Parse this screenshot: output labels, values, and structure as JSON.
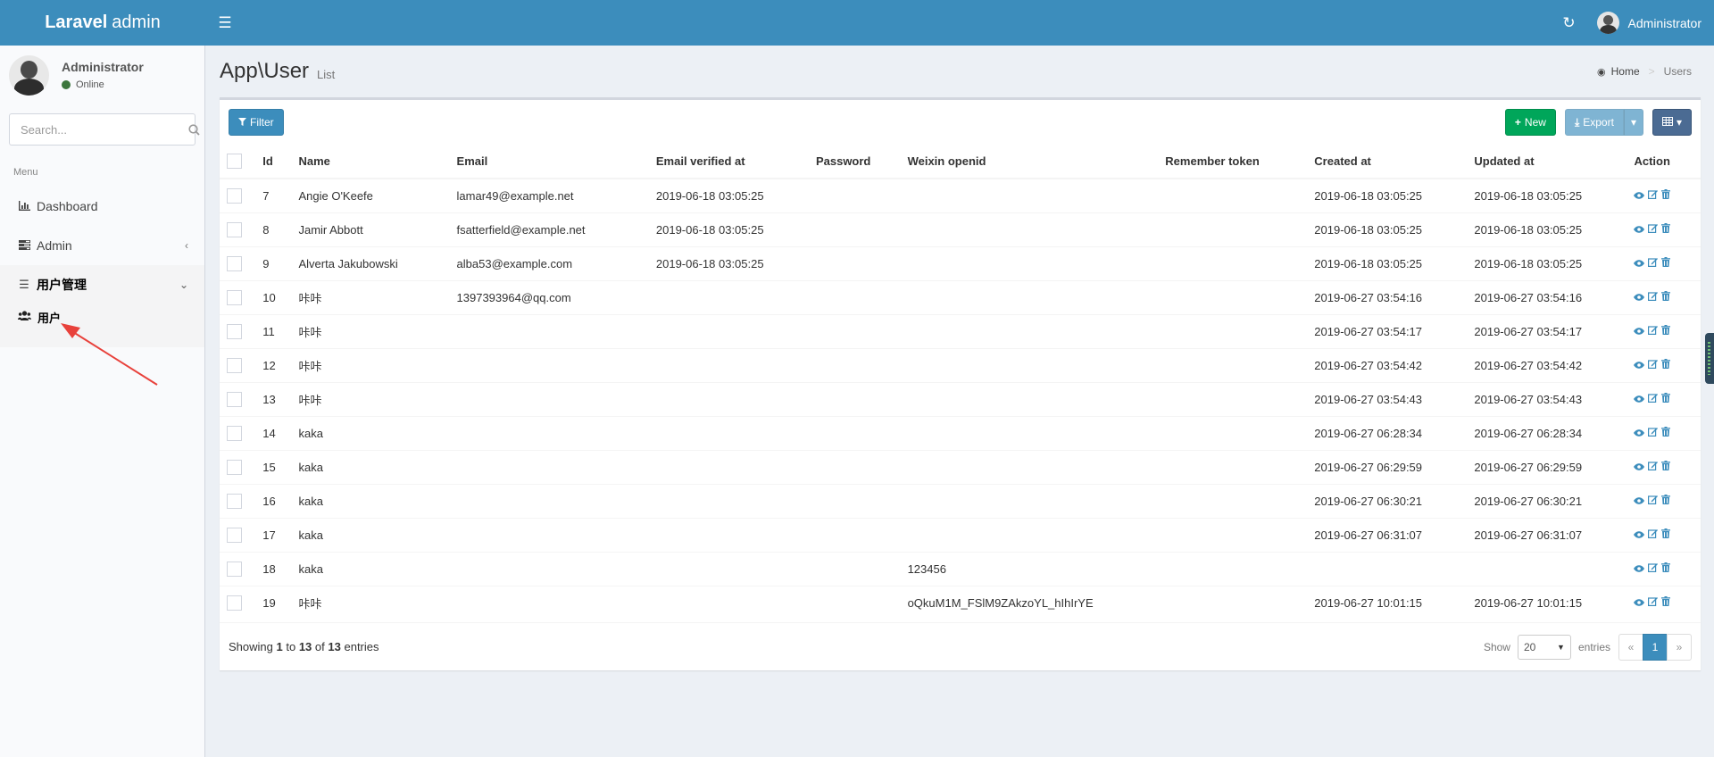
{
  "header": {
    "logo_bold": "Laravel",
    "logo_thin": "admin",
    "user_name": "Administrator"
  },
  "sidebar": {
    "user_name": "Administrator",
    "status": "Online",
    "search_placeholder": "Search...",
    "menu_header": "Menu",
    "items": [
      {
        "label": "Dashboard",
        "icon": "bar-chart-icon"
      },
      {
        "label": "Admin",
        "icon": "tasks-icon"
      },
      {
        "label": "用户管理",
        "icon": "bars-icon"
      }
    ],
    "subitems": [
      {
        "label": "用户",
        "icon": "users-icon"
      }
    ]
  },
  "page": {
    "title": "App\\User",
    "subtitle": "List",
    "breadcrumb": [
      "Home",
      "Users"
    ]
  },
  "toolbar": {
    "filter_label": "Filter",
    "new_label": "New",
    "export_label": "Export"
  },
  "table": {
    "columns": [
      "Id",
      "Name",
      "Email",
      "Email verified at",
      "Password",
      "Weixin openid",
      "Remember token",
      "Created at",
      "Updated at",
      "Action"
    ],
    "rows": [
      {
        "id": "7",
        "name": "Angie O'Keefe",
        "email": "lamar49@example.net",
        "verified": "2019-06-18 03:05:25",
        "password": "",
        "openid": "",
        "token": "",
        "created": "2019-06-18 03:05:25",
        "updated": "2019-06-18 03:05:25"
      },
      {
        "id": "8",
        "name": "Jamir Abbott",
        "email": "fsatterfield@example.net",
        "verified": "2019-06-18 03:05:25",
        "password": "",
        "openid": "",
        "token": "",
        "created": "2019-06-18 03:05:25",
        "updated": "2019-06-18 03:05:25"
      },
      {
        "id": "9",
        "name": "Alverta Jakubowski",
        "email": "alba53@example.com",
        "verified": "2019-06-18 03:05:25",
        "password": "",
        "openid": "",
        "token": "",
        "created": "2019-06-18 03:05:25",
        "updated": "2019-06-18 03:05:25"
      },
      {
        "id": "10",
        "name": "咔咔",
        "email": "1397393964@qq.com",
        "verified": "",
        "password": "",
        "openid": "",
        "token": "",
        "created": "2019-06-27 03:54:16",
        "updated": "2019-06-27 03:54:16"
      },
      {
        "id": "11",
        "name": "咔咔",
        "email": "",
        "verified": "",
        "password": "",
        "openid": "",
        "token": "",
        "created": "2019-06-27 03:54:17",
        "updated": "2019-06-27 03:54:17"
      },
      {
        "id": "12",
        "name": "咔咔",
        "email": "",
        "verified": "",
        "password": "",
        "openid": "",
        "token": "",
        "created": "2019-06-27 03:54:42",
        "updated": "2019-06-27 03:54:42"
      },
      {
        "id": "13",
        "name": "咔咔",
        "email": "",
        "verified": "",
        "password": "",
        "openid": "",
        "token": "",
        "created": "2019-06-27 03:54:43",
        "updated": "2019-06-27 03:54:43"
      },
      {
        "id": "14",
        "name": "kaka",
        "email": "",
        "verified": "",
        "password": "",
        "openid": "",
        "token": "",
        "created": "2019-06-27 06:28:34",
        "updated": "2019-06-27 06:28:34"
      },
      {
        "id": "15",
        "name": "kaka",
        "email": "",
        "verified": "",
        "password": "",
        "openid": "",
        "token": "",
        "created": "2019-06-27 06:29:59",
        "updated": "2019-06-27 06:29:59"
      },
      {
        "id": "16",
        "name": "kaka",
        "email": "",
        "verified": "",
        "password": "",
        "openid": "",
        "token": "",
        "created": "2019-06-27 06:30:21",
        "updated": "2019-06-27 06:30:21"
      },
      {
        "id": "17",
        "name": "kaka",
        "email": "",
        "verified": "",
        "password": "",
        "openid": "",
        "token": "",
        "created": "2019-06-27 06:31:07",
        "updated": "2019-06-27 06:31:07"
      },
      {
        "id": "18",
        "name": "kaka",
        "email": "",
        "verified": "",
        "password": "",
        "openid": "123456",
        "token": "",
        "created": "",
        "updated": ""
      },
      {
        "id": "19",
        "name": "咔咔",
        "email": "",
        "verified": "",
        "password": "",
        "openid": "oQkuM1M_FSlM9ZAkzoYL_hIhIrYE",
        "token": "",
        "created": "2019-06-27 10:01:15",
        "updated": "2019-06-27 10:01:15"
      }
    ]
  },
  "footer": {
    "showing_prefix": "Showing",
    "from": "1",
    "to_word": "to",
    "to": "13",
    "of_word": "of",
    "total": "13",
    "entries_word": "entries",
    "show_label": "Show",
    "per_page": "20",
    "entries_label": "entries",
    "prev": "«",
    "page": "1",
    "next": "»"
  },
  "colors": {
    "header": "#3c8dbc",
    "new_button": "#00a65a",
    "action_link": "#3c8dbc",
    "annotation_arrow": "#e8413b"
  }
}
